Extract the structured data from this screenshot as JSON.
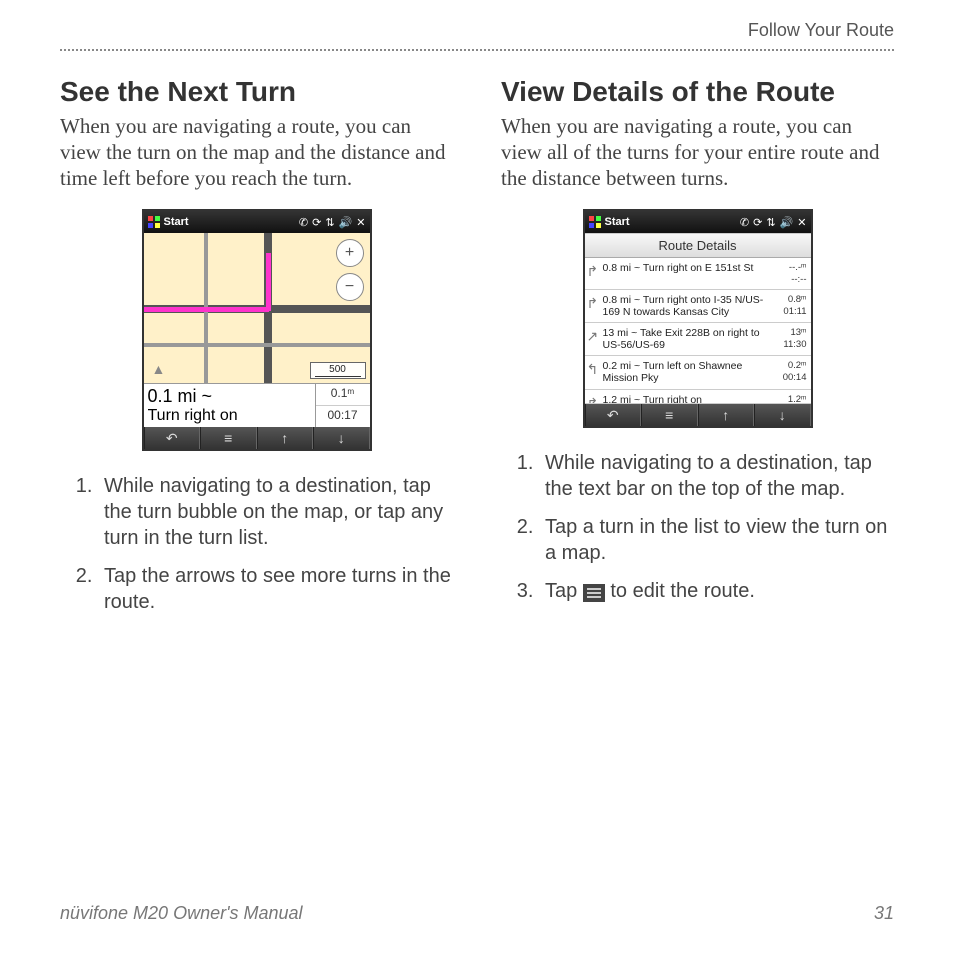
{
  "header": {
    "breadcrumb": "Follow Your Route"
  },
  "footer": {
    "manual": "nüvifone M20 Owner's Manual",
    "page": "31"
  },
  "left": {
    "heading": "See the Next Turn",
    "intro": "When you are navigating a route, you can view the turn on the map and the distance and time left before you reach the turn.",
    "device": {
      "start": "Start",
      "scale": "500",
      "turn_distance": "0.1 mi ~",
      "turn_text": "Turn right on",
      "mini_dist": "0.1ᵐ",
      "mini_time": "00:17"
    },
    "steps": [
      "While navigating to a destination, tap the turn bubble on the map, or tap any turn in the turn list.",
      "Tap the arrows to see more turns in the route."
    ]
  },
  "right": {
    "heading": "View Details of the Route",
    "intro": "When you are navigating a route, you can view all of the turns for your entire route and the distance between turns.",
    "device": {
      "start": "Start",
      "title": "Route Details",
      "rows": [
        {
          "arrow": "↱",
          "text": "0.8 mi ~ Turn right on E 151st St",
          "dist": "--.-ᵐ",
          "time": "--:--"
        },
        {
          "arrow": "↱",
          "text": "0.8 mi ~ Turn right onto I-35 N/US-169 N towards Kansas City",
          "dist": "0.8ᵐ",
          "time": "01:11"
        },
        {
          "arrow": "↗",
          "text": "13 mi ~ Take Exit 228B on right to US-56/US-69",
          "dist": "13ᵐ",
          "time": "11:30"
        },
        {
          "arrow": "↰",
          "text": "0.2 mi ~ Turn left on Shawnee Mission Pky",
          "dist": "0.2ᵐ",
          "time": "00:14"
        },
        {
          "arrow": "↱",
          "text": "1.2 mi ~ Turn right on",
          "dist": "1.2ᵐ",
          "time": ""
        }
      ]
    },
    "steps": [
      "While navigating to a destination, tap the text bar on the top of the map.",
      "Tap a turn in the list to view the turn on a map."
    ],
    "step3_prefix": "Tap ",
    "step3_suffix": " to edit the route."
  }
}
